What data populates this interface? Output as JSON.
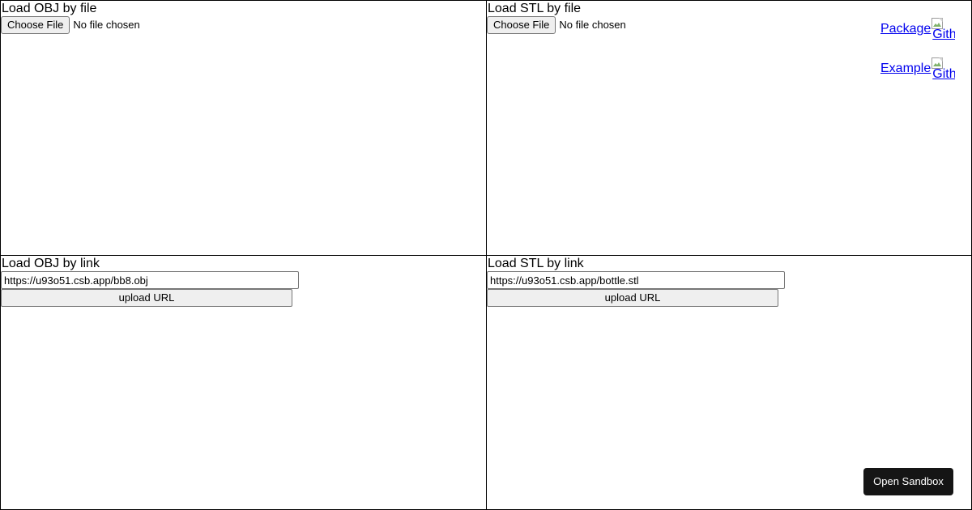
{
  "panels": {
    "obj_file": {
      "title": "Load OBJ by file",
      "choose_label": "Choose File",
      "status": "No file chosen"
    },
    "stl_file": {
      "title": "Load STL by file",
      "choose_label": "Choose File",
      "status": "No file chosen"
    },
    "obj_link": {
      "title": "Load OBJ by link",
      "url_value": "https://u93o51.csb.app/bb8.obj",
      "upload_label": "upload URL"
    },
    "stl_link": {
      "title": "Load STL by link",
      "url_value": "https://u93o51.csb.app/bottle.stl",
      "upload_label": "upload URL"
    }
  },
  "links": {
    "package": {
      "label": "Package",
      "img_alt": "Github"
    },
    "example": {
      "label": "Example",
      "img_alt": "Github"
    }
  },
  "sandbox_button": {
    "label": "Open Sandbox"
  },
  "colors": {
    "link": "#0000ee",
    "sandbox_bg": "#151515",
    "button_bg": "#efefef",
    "border": "#000000"
  }
}
